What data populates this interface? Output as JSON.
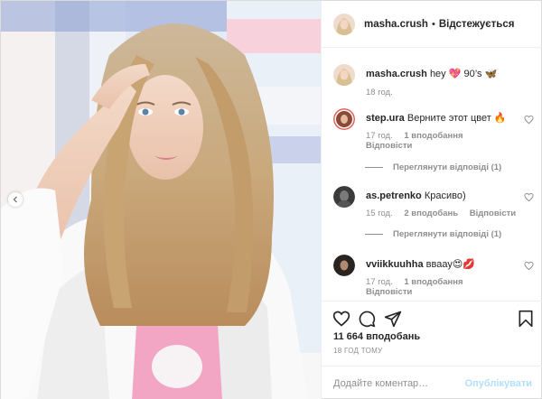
{
  "post": {
    "photo_alt": "photo",
    "nav_left_icon": "chevron-left-icon"
  },
  "header": {
    "username": "masha.crush",
    "separator": "•",
    "follow_label": "Відстежується"
  },
  "caption": {
    "username": "masha.crush",
    "text_prefix": "hey ",
    "emoji_1": "💖",
    "text_mid": " 90’s ",
    "emoji_2": "🦋",
    "time": "18 год."
  },
  "comments": [
    {
      "username": "step.ura",
      "text": "Верните этот цвет 🔥",
      "time": "17 год.",
      "likes": "1 вподобання",
      "reply_label": "Відповісти",
      "view_replies": "Переглянути відповіді (1)"
    },
    {
      "username": "as.petrenko",
      "text": "Красиво)",
      "time": "15 год.",
      "likes": "2 вподобань",
      "reply_label": "Відповісти",
      "view_replies": "Переглянути відповіді (1)"
    },
    {
      "username": "vviikkuuhha",
      "text": "вваау😍💋",
      "time": "17 год.",
      "likes": "1 вподобання",
      "reply_label": "Відповісти"
    }
  ],
  "actions": {
    "like_icon": "heart-icon",
    "comment_icon": "comment-icon",
    "share_icon": "send-icon",
    "save_icon": "bookmark-icon"
  },
  "likes_text": "11 664 вподобань",
  "post_time": "18 ГОД ТОМУ",
  "add_comment": {
    "placeholder": "Додайте коментар…",
    "publish_label": "Опублікувати"
  },
  "colors": {
    "link_disabled": "#b2dffc",
    "muted": "#8e8e8e",
    "text": "#262626",
    "border": "#efefef"
  }
}
